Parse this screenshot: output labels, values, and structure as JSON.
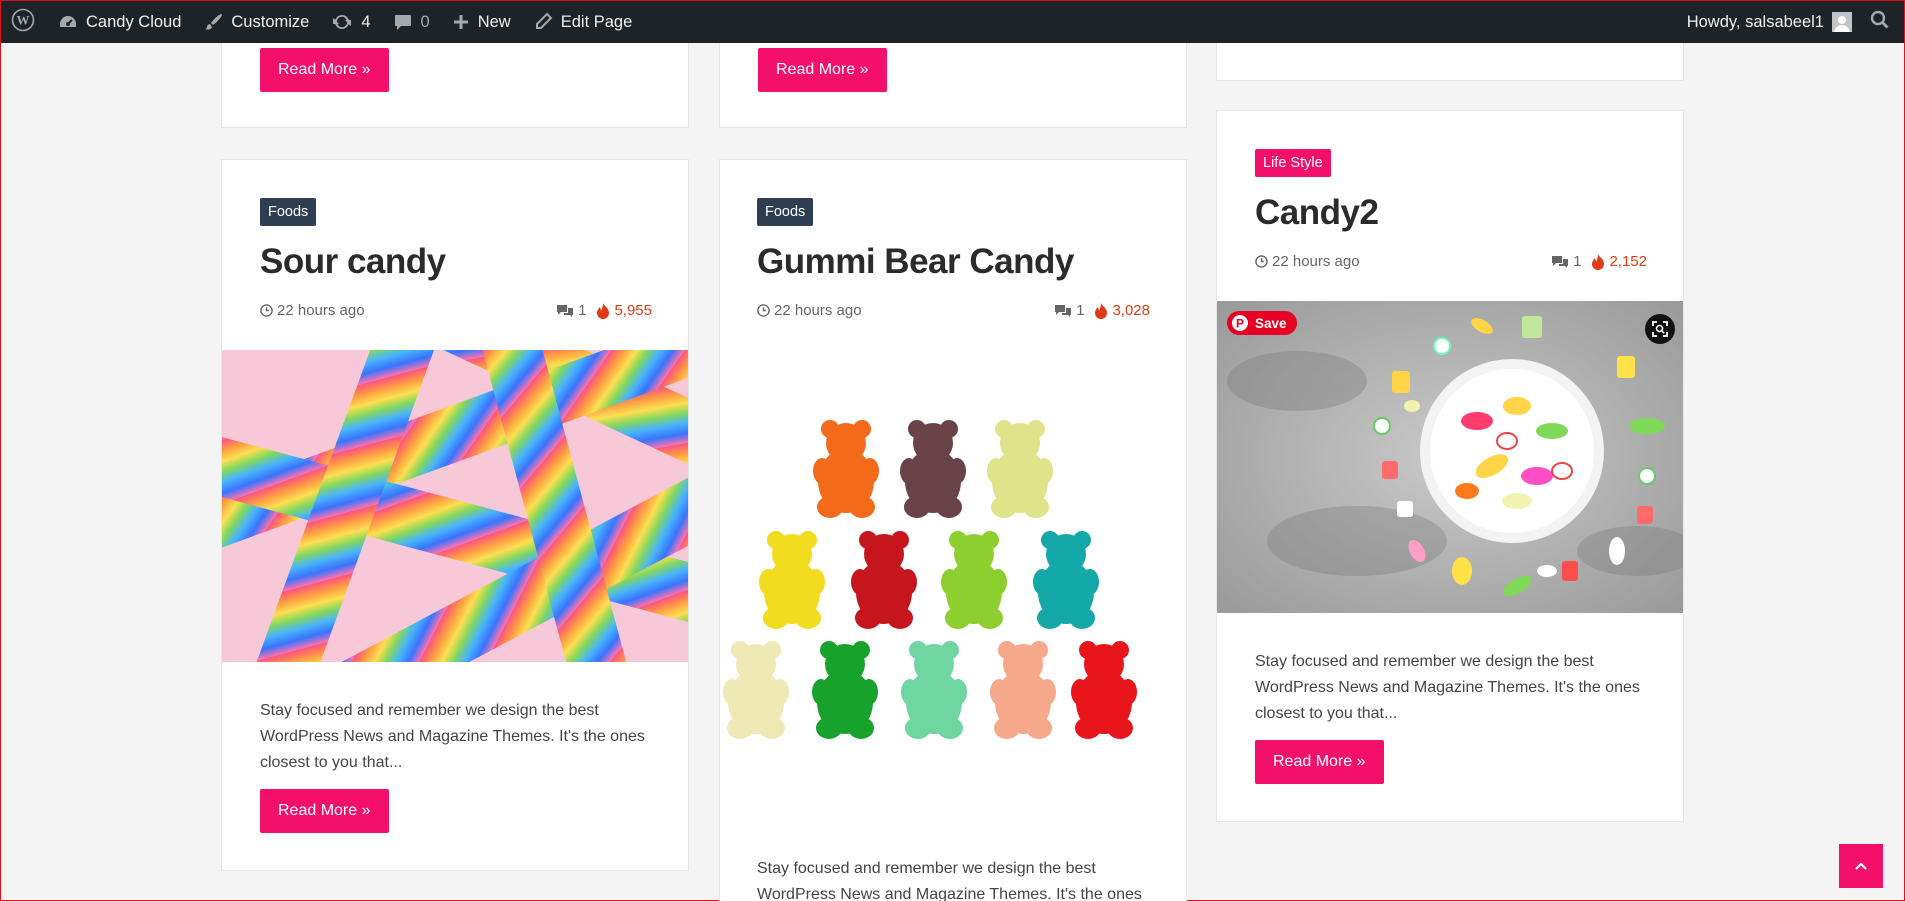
{
  "adminbar": {
    "site_name": "Candy Cloud",
    "customize": "Customize",
    "updates_count": "4",
    "comments_count": "0",
    "new_label": "New",
    "edit_page": "Edit Page",
    "howdy": "Howdy, salsabeel1"
  },
  "top_row": {
    "read_more_1": "Read More »",
    "read_more_2": "Read More »"
  },
  "posts": [
    {
      "category": "Foods",
      "title": "Sour candy",
      "time": "22 hours ago",
      "comments": "1",
      "views": "5,955",
      "excerpt": "Stay focused and remember we design the best WordPress News and Magazine Themes. It's the ones closest to you that...",
      "read_more": "Read More »"
    },
    {
      "category": "Foods",
      "title": "Gummi Bear Candy",
      "time": "22 hours ago",
      "comments": "1",
      "views": "3,028",
      "excerpt": "Stay focused and remember we design the best WordPress News and Magazine Themes. It's the ones"
    },
    {
      "category": "Life Style",
      "title": "Candy2",
      "time": "22 hours ago",
      "comments": "1",
      "views": "2,152",
      "pin_save": "Save",
      "excerpt": "Stay focused and remember we design the best WordPress News and Magazine Themes. It's the ones closest to you that...",
      "read_more": "Read More »"
    }
  ],
  "colors": {
    "accent": "#f3106b",
    "category_dark": "#2d3e50",
    "adminbar": "#1d2327",
    "views": "#e03b16",
    "pinterest": "#e60023"
  }
}
